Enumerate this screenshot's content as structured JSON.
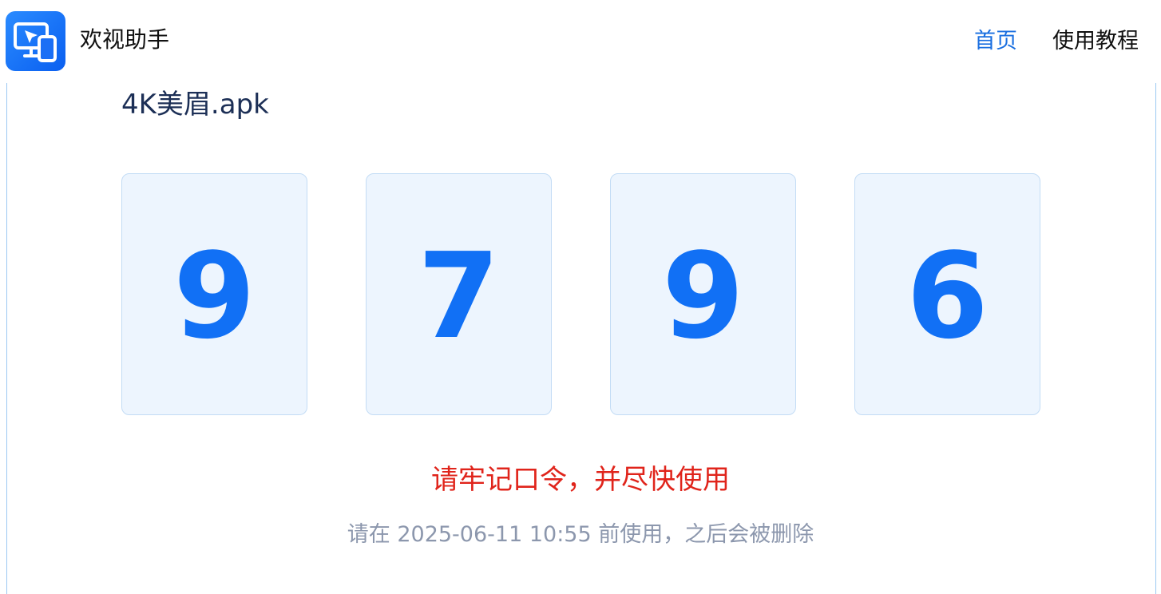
{
  "header": {
    "app_name": "欢视助手",
    "nav": {
      "home": "首页",
      "tutorial": "使用教程"
    }
  },
  "file": {
    "name": "4K美眉.apk"
  },
  "code": {
    "digits": [
      "9",
      "7",
      "9",
      "6"
    ]
  },
  "notice": {
    "warning": "请牢记口令，并尽快使用",
    "expire": "请在 2025-06-11 10:55 前使用，之后会被删除"
  },
  "colors": {
    "accent": "#1170f5",
    "nav_active": "#1a6fe0",
    "warning": "#e0241b",
    "muted": "#8c97ad",
    "digit_box_bg": "#edf5fe"
  },
  "icons": {
    "logo": "screen-cast-logo-icon"
  }
}
